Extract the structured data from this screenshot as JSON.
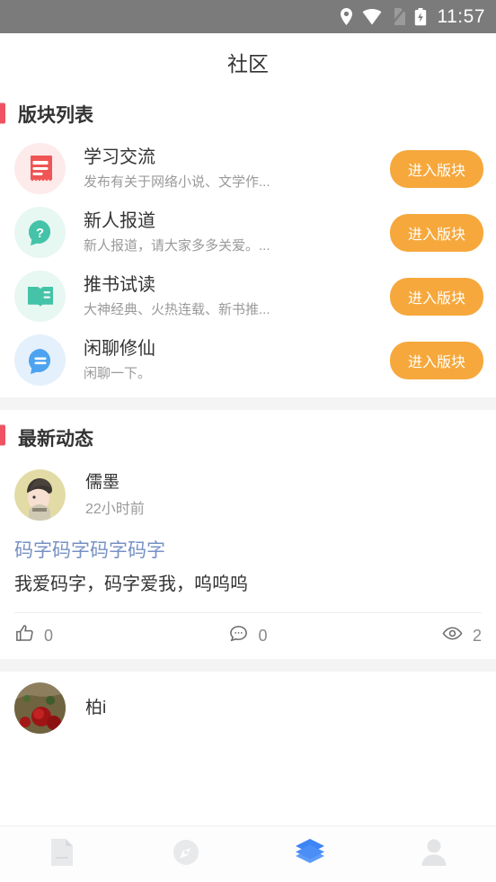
{
  "status_bar": {
    "time": "11:57",
    "icons": [
      "location-pin-icon",
      "wifi-icon",
      "sim-card-off-icon",
      "battery-charging-icon"
    ],
    "background": "#7b7b7b"
  },
  "header": {
    "title": "社区"
  },
  "board_section": {
    "title": "版块列表",
    "accent_color": "#ef5362",
    "button_color": "#f6a83c",
    "items": [
      {
        "name": "学习交流",
        "desc": "发布有关于网络小说、文学作...",
        "button": "进入版块",
        "icon": "document-icon",
        "icon_color": "#f05555",
        "icon_bg": "#fdeaea"
      },
      {
        "name": "新人报道",
        "desc": "新人报道，请大家多多关爱。...",
        "button": "进入版块",
        "icon": "question-bubble-icon",
        "icon_color": "#44c3a8",
        "icon_bg": "#e7f7f2"
      },
      {
        "name": "推书试读",
        "desc": "大神经典、火热连载、新书推...",
        "button": "进入版块",
        "icon": "open-book-icon",
        "icon_color": "#44c3a8",
        "icon_bg": "#e7f7f2"
      },
      {
        "name": "闲聊修仙",
        "desc": "闲聊一下。",
        "button": "进入版块",
        "icon": "chat-bubble-icon",
        "icon_color": "#4da3ef",
        "icon_bg": "#e4f0fc"
      }
    ]
  },
  "feed_section": {
    "title": "最新动态",
    "accent_color": "#ef5362",
    "posts": [
      {
        "user": "儒墨",
        "time": "22小时前",
        "title": "码字码字码字码字",
        "body": "我爱码字，码字爱我，呜呜呜",
        "avatar": "beanie-character-avatar",
        "likes": "0",
        "comments": "0",
        "views": "2"
      },
      {
        "user": "柏i",
        "avatar": "red-rose-avatar"
      }
    ]
  },
  "bottom_nav": {
    "active_color": "#3d84f5",
    "inactive_color": "#e3e4e6",
    "items": [
      {
        "icon": "bookshelf-icon",
        "active": false
      },
      {
        "icon": "compass-icon",
        "active": false
      },
      {
        "icon": "layers-icon",
        "active": true
      },
      {
        "icon": "person-icon",
        "active": false
      }
    ]
  }
}
